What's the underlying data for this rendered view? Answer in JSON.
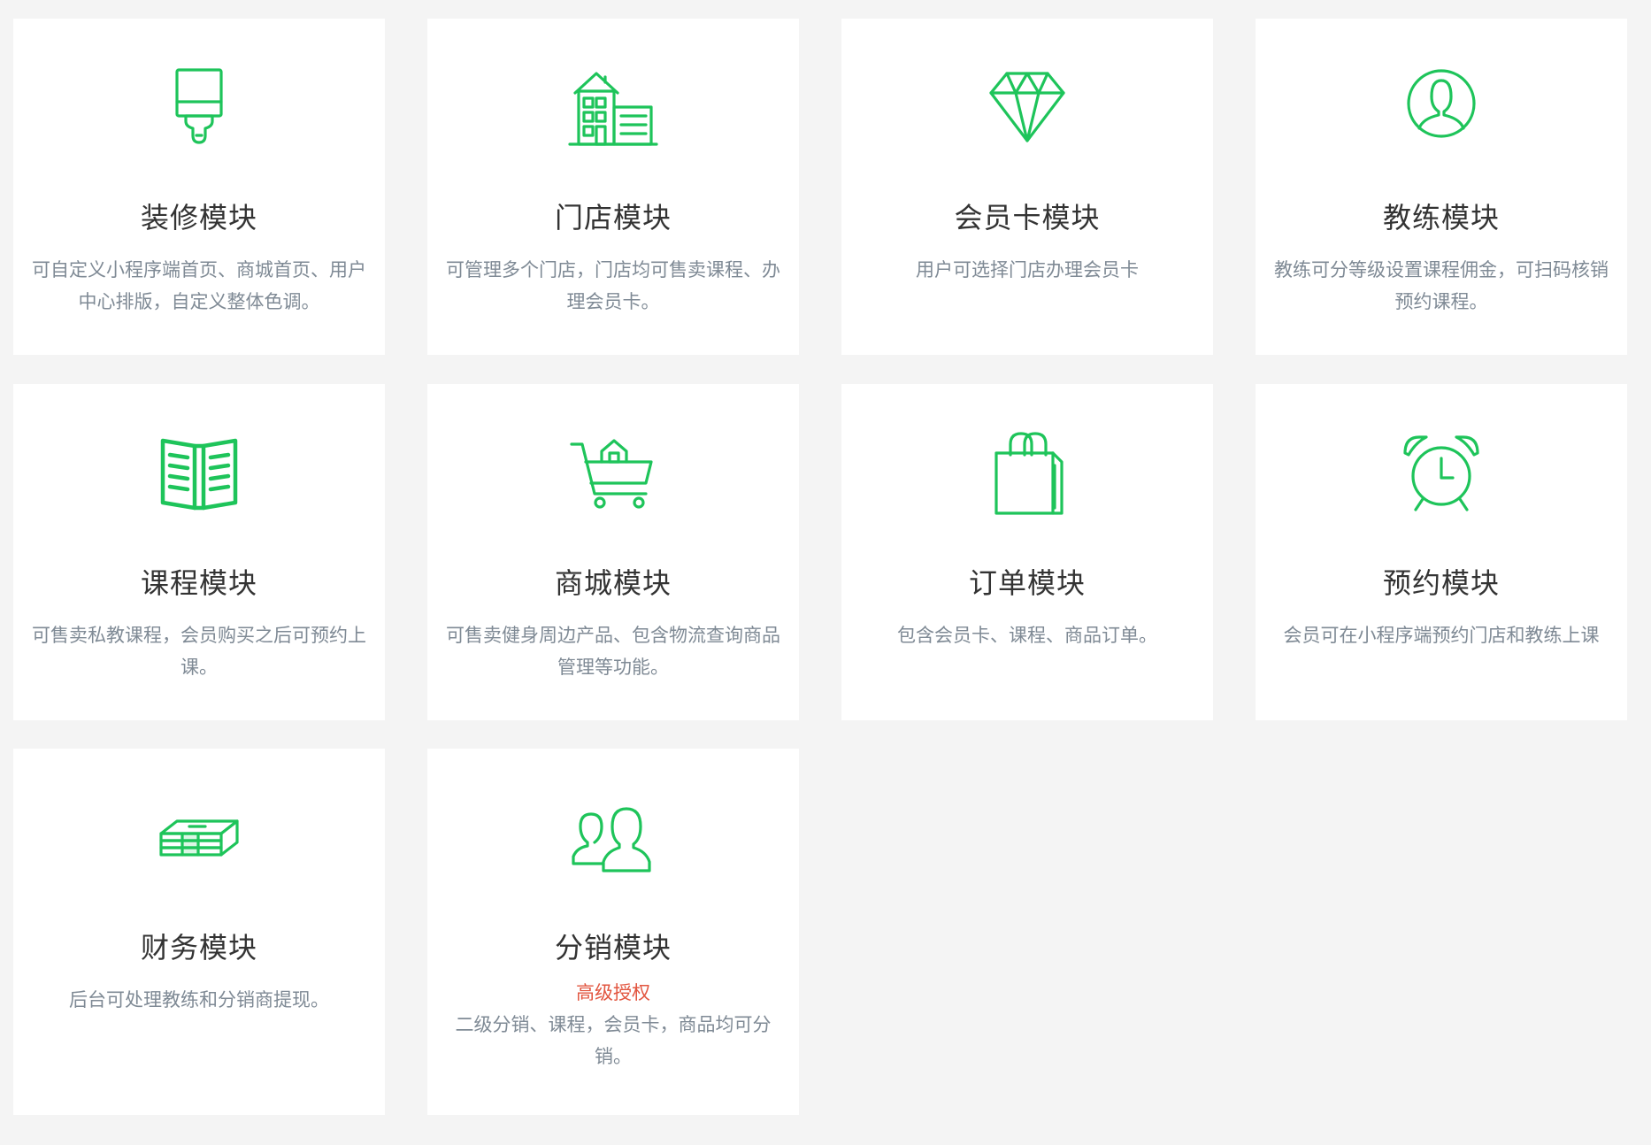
{
  "accent_color": "#1ec45a",
  "modules": [
    {
      "icon": "paint-brush-icon",
      "title": "装修模块",
      "desc": "可自定义小程序端首页、商城首页、用户中心排版，自定义整体色调。"
    },
    {
      "icon": "store-building-icon",
      "title": "门店模块",
      "desc": "可管理多个门店，门店均可售卖课程、办理会员卡。"
    },
    {
      "icon": "diamond-icon",
      "title": "会员卡模块",
      "desc": "用户可选择门店办理会员卡"
    },
    {
      "icon": "user-circle-icon",
      "title": "教练模块",
      "desc": "教练可分等级设置课程佣金，可扫码核销预约课程。"
    },
    {
      "icon": "open-book-icon",
      "title": "课程模块",
      "desc": "可售卖私教课程，会员购买之后可预约上课。"
    },
    {
      "icon": "shopping-cart-icon",
      "title": "商城模块",
      "desc": "可售卖健身周边产品、包含物流查询商品管理等功能。"
    },
    {
      "icon": "shopping-bag-icon",
      "title": "订单模块",
      "desc": "包含会员卡、课程、商品订单。"
    },
    {
      "icon": "alarm-clock-icon",
      "title": "预约模块",
      "desc": "会员可在小程序端预约门店和教练上课"
    },
    {
      "icon": "money-stack-icon",
      "title": "财务模块",
      "desc": "后台可处理教练和分销商提现。"
    },
    {
      "icon": "users-icon",
      "title": "分销模块",
      "badge": "高级授权",
      "desc": "二级分销、课程，会员卡，商品均可分销。"
    }
  ]
}
